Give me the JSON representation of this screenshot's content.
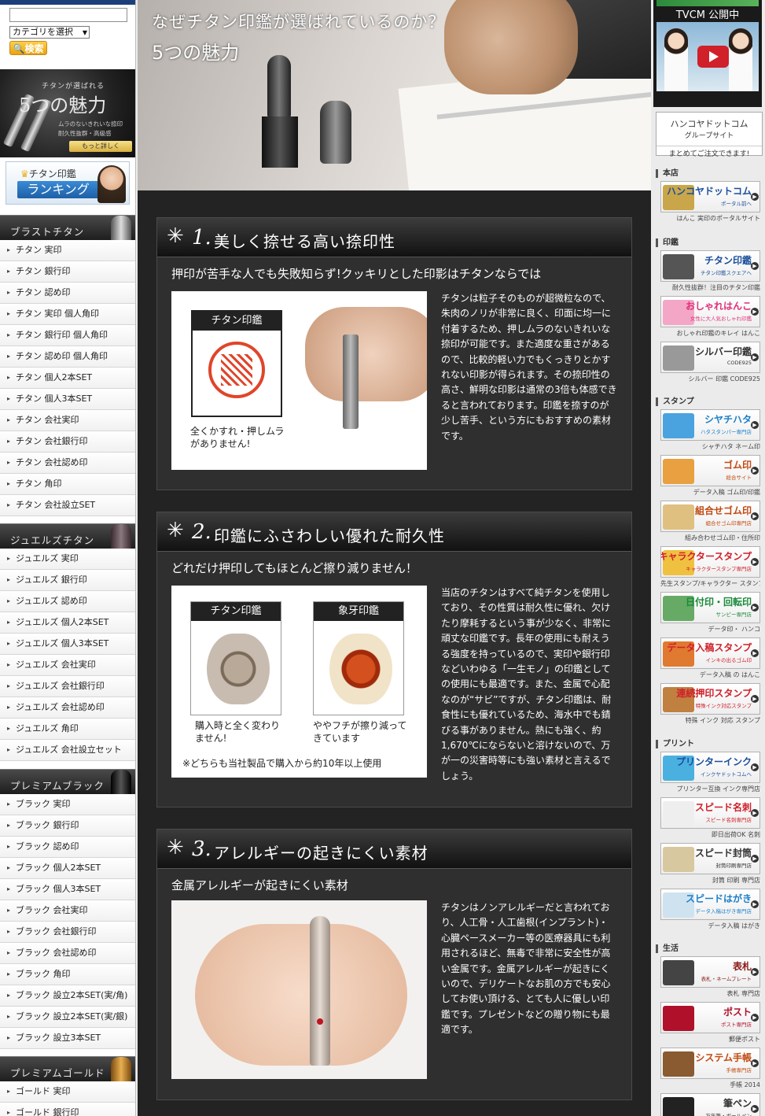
{
  "left": {
    "search_placeholder": "",
    "category_select": "カテゴリを選択",
    "search_button": "検索",
    "banner5": {
      "subtitle": "チタンが選ばれる",
      "title": "5つの魅力",
      "desc1": "ムラのないきれいな捺印",
      "desc2": "耐久性抜群・高級感",
      "more": "もっと詳しく"
    },
    "ranking": {
      "line1": "チタン印鑑",
      "line2": "ランキング"
    },
    "sections": [
      {
        "title": "ブラストチタン",
        "items": [
          "チタン 実印",
          "チタン 銀行印",
          "チタン 認め印",
          "チタン 実印 個人角印",
          "チタン 銀行印 個人角印",
          "チタン 認め印 個人角印",
          "チタン 個人2本SET",
          "チタン 個人3本SET",
          "チタン 会社実印",
          "チタン 会社銀行印",
          "チタン 会社認め印",
          "チタン 角印",
          "チタン 会社設立SET"
        ]
      },
      {
        "title": "ジュエルズチタン",
        "items": [
          "ジュエルズ 実印",
          "ジュエルズ 銀行印",
          "ジュエルズ 認め印",
          "ジュエルズ 個人2本SET",
          "ジュエルズ 個人3本SET",
          "ジュエルズ 会社実印",
          "ジュエルズ 会社銀行印",
          "ジュエルズ 会社認め印",
          "ジュエルズ 角印",
          "ジュエルズ 会社設立セット"
        ]
      },
      {
        "title": "プレミアムブラック",
        "items": [
          "ブラック 実印",
          "ブラック 銀行印",
          "ブラック 認め印",
          "ブラック 個人2本SET",
          "ブラック 個人3本SET",
          "ブラック 会社実印",
          "ブラック 会社銀行印",
          "ブラック 会社認め印",
          "ブラック 角印",
          "ブラック 設立2本SET(実/角)",
          "ブラック 設立2本SET(実/銀)",
          "ブラック 設立3本SET"
        ]
      },
      {
        "title": "プレミアムゴールド",
        "items": [
          "ゴールド 実印",
          "ゴールド 銀行印"
        ]
      }
    ]
  },
  "hero": {
    "title": "なぜチタン印鑑が選ばれているのか？",
    "subtitle": "5つの魅力"
  },
  "features": [
    {
      "star": "✳",
      "num": "1.",
      "title": "美しく捺せる高い捺印性",
      "lead": "押印が苦手な人でも失敗知らず!クッキリとした印影はチタンならでは",
      "img": {
        "card": "チタン印鑑",
        "caption1": "全くかすれ・押しムラ",
        "caption2": "がありません!"
      },
      "text": "チタンは粒子そのものが超微粒なので、朱肉のノリが非常に良く、印面に均一に付着するため、押しムラのないきれいな捺印が可能です。また適度な重さがあるので、比較的軽い力でもくっきりとかすれない印影が得られます。その捺印性の高さ、鮮明な印影は通常の3倍も体感できると言われております。印鑑を捺すのが少し苦手、という方にもおすすめの素材です。"
    },
    {
      "star": "✳",
      "num": "2.",
      "title": "印鑑にふさわしい優れた耐久性",
      "lead": "どれだけ押印してもほとんど擦り減りません！",
      "img": {
        "card_a": "チタン印鑑",
        "cap_a1": "購入時と全く変わり",
        "cap_a2": "ません!",
        "card_b": "象牙印鑑",
        "cap_b1": "ややフチが擦り減って",
        "cap_b2": "きています",
        "note": "※どちらも当社製品で購入から約10年以上使用"
      },
      "text": "当店のチタンはすべて純チタンを使用しており、その性質は耐久性に優れ、欠けたり摩耗するという事が少なく、非常に頑丈な印鑑です。長年の使用にも耐えうる強度を持っているので、実印や銀行印などいわゆる「一生モノ」の印鑑としての使用にも最適です。また、金属で心配なのが“サビ”ですが、チタン印鑑は、耐食性にも優れているため、海水中でも錆びる事がありません。熱にも強く、約1,670℃にならないと溶けないので、万が一の災害時等にも強い素材と言えるでしょう。"
    },
    {
      "star": "✳",
      "num": "3.",
      "title": "アレルギーの起きにくい素材",
      "lead": "金属アレルギーが起きにくい素材",
      "text": "チタンはノンアレルギーだと言われており、人工骨・人工歯根(インプラント)・心臓ペースメーカー等の医療器具にも利用されるほど、無毒で非常に安全性が高い金属です。金属アレルギーが起きにくいので、デリケートなお肌の方でも安心してお使い頂ける、とても人に優しい印鑑です。プレゼントなどの贈り物にも最適です。"
    }
  ],
  "right": {
    "tvcm": "TVCM 公開中",
    "group": {
      "line1": "ハンコヤドットコム",
      "line2": "グループサイト",
      "line3": "まとめてご注文できます!"
    },
    "sections": [
      {
        "title": "本店",
        "banners": [
          {
            "t": "ハンコヤドットコム",
            "s": "ポータル前へ",
            "cap": "はんこ 実印のポータルサイト",
            "color": "#1b4f9c",
            "img": "#c9a64a"
          }
        ]
      },
      {
        "title": "印鑑",
        "banners": [
          {
            "t": "チタン印鑑",
            "s": "チタン印鑑スクエアへ",
            "cap": "耐久性抜群！注目のチタン印鑑",
            "color": "#1b4f9c",
            "img": "#555"
          },
          {
            "t": "おしゃれはんこ",
            "s": "女性に大人気おしゃれ印鑑",
            "cap": "おしゃれ印鑑のキレイ はんこ",
            "color": "#e0307a",
            "img": "#f4a6c6"
          },
          {
            "t": "シルバー印鑑",
            "s": "CODE925",
            "cap": "シルバー 印鑑 CODE925",
            "color": "#333",
            "img": "#999"
          }
        ]
      },
      {
        "title": "スタンプ",
        "banners": [
          {
            "t": "シヤチハタ",
            "s": "ハタスタンパー専門店",
            "cap": "シャチハタ ネーム印",
            "color": "#1b7fc9",
            "img": "#4aa3df"
          },
          {
            "t": "ゴム印",
            "s": "総合サイト",
            "cap": "データ入稿 ゴム印/印鑑",
            "color": "#c24a10",
            "img": "#e8a040"
          },
          {
            "t": "組合せゴム印",
            "s": "組合せゴム印専門店",
            "cap": "組み合わせゴム印・住所印",
            "color": "#c24a10",
            "img": "#e0c080"
          },
          {
            "t": "キャラクタースタンプ",
            "s": "キャラクタースタンプ専門店",
            "cap": "先生スタンプ/キャラクター スタンプ",
            "color": "#d0202a",
            "img": "#f0c040"
          },
          {
            "t": "日付印・回転印",
            "s": "サンビー専門店",
            "cap": "データ印・ ハンコ",
            "color": "#1a8a3a",
            "img": "#6a6"
          },
          {
            "t": "データ入稿スタンプ",
            "s": "インキの出るゴム印",
            "cap": "データ入稿 の はんこ",
            "color": "#d0202a",
            "img": "#e07a30"
          },
          {
            "t": "連続押印スタンプ",
            "s": "特殊インク対応スタンプ",
            "cap": "特殊 インク 対応 スタンプ",
            "color": "#d0202a",
            "img": "#c08040"
          }
        ]
      },
      {
        "title": "プリント",
        "banners": [
          {
            "t": "プリンターインク",
            "s": "インクヤドットコムへ",
            "cap": "プリンター互換 インク専門店",
            "color": "#1b4f9c",
            "img": "#4ab0e0"
          },
          {
            "t": "スピード名刺",
            "s": "スピード名刺専門店",
            "cap": "即日出荷OK 名刺",
            "color": "#d0202a",
            "img": "#eee"
          },
          {
            "t": "スピード封筒",
            "s": "封筒印刷専門店",
            "cap": "封筒 印刷 専門店",
            "color": "#333",
            "img": "#d8c8a0"
          },
          {
            "t": "スピードはがき",
            "s": "データ入稿はがき専門店",
            "cap": "データ入稿 はがき",
            "color": "#1b7fc9",
            "img": "#cfe2f0"
          }
        ]
      },
      {
        "title": "生活",
        "banners": [
          {
            "t": "表札",
            "s": "表札・ネームプレート",
            "cap": "表札 専門店",
            "color": "#8a1a1a",
            "img": "#444"
          },
          {
            "t": "ポスト",
            "s": "ポスト専門店",
            "cap": "郵便ポスト",
            "color": "#fff",
            "img": "#b0102a"
          },
          {
            "t": "システム手帳",
            "s": "手帳専門店",
            "cap": "手帳 2014",
            "color": "#c24a10",
            "img": "#8a5a30"
          },
          {
            "t": "筆ペン",
            "s": "万年筆・ボールペン",
            "cap": "",
            "color": "#333",
            "img": "#222"
          }
        ]
      }
    ]
  },
  "colors": {
    "sidebar_nav": "#1c3f7a",
    "feature_bg": "#2f2f2f",
    "page_dark": "#232323",
    "search_button": "#f0b224"
  }
}
